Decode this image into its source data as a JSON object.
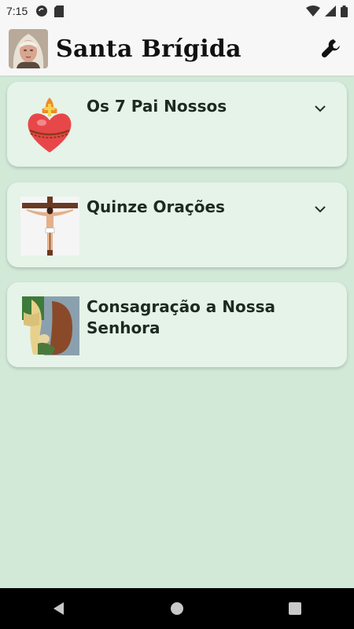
{
  "status_bar": {
    "time": "7:15"
  },
  "app_bar": {
    "title": "Santa Brígida",
    "settings_icon": "wrench-icon"
  },
  "cards": [
    {
      "title": "Os 7 Pai Nossos",
      "icon": "sacred-heart-icon",
      "expandable": true
    },
    {
      "title": "Quinze Orações",
      "icon": "crucifix-icon",
      "expandable": true
    },
    {
      "title": "Consagração a Nossa Senhora",
      "icon": "pieta-icon",
      "expandable": false
    }
  ],
  "nav_bar": {
    "back_icon": "back-triangle-icon",
    "home_icon": "home-circle-icon",
    "recents_icon": "recents-square-icon"
  },
  "colors": {
    "background": "#d2e9d8",
    "card": "#e6f3e8",
    "app_bar": "#f7f7f7"
  }
}
